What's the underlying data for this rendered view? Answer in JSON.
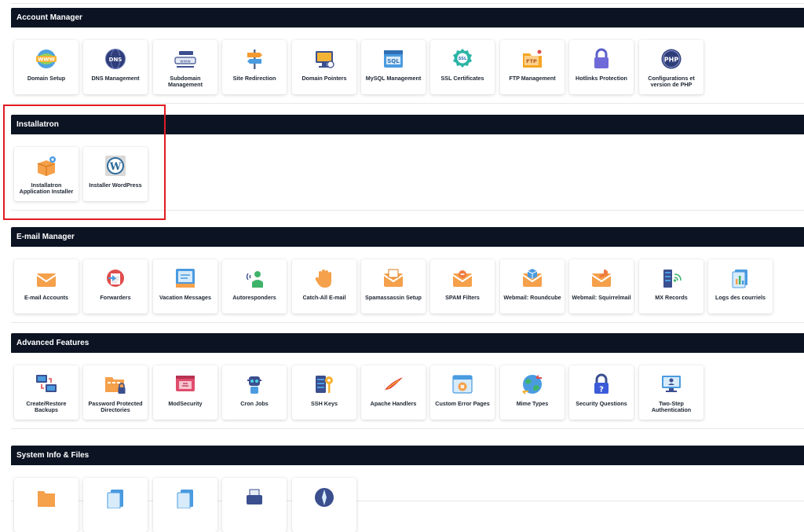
{
  "sections": [
    {
      "title": "Account Manager",
      "items": [
        {
          "label": "Domain Setup",
          "icon": "www-globe-icon"
        },
        {
          "label": "DNS Management",
          "icon": "dns-globe-icon"
        },
        {
          "label": "Subdomain Management",
          "icon": "subdomain-icon"
        },
        {
          "label": "Site Redirection",
          "icon": "signpost-icon"
        },
        {
          "label": "Domain Pointers",
          "icon": "domain-pointer-icon"
        },
        {
          "label": "MySQL Management",
          "icon": "sql-icon"
        },
        {
          "label": "SSL Certificates",
          "icon": "ssl-badge-icon"
        },
        {
          "label": "FTP Management",
          "icon": "ftp-folder-icon"
        },
        {
          "label": "Hotlinks Protection",
          "icon": "padlock-icon"
        },
        {
          "label": "Configurations et version de PHP",
          "icon": "php-icon"
        }
      ]
    },
    {
      "title": "Installatron",
      "items": [
        {
          "label": "Installatron Application Installer",
          "icon": "installatron-box-icon"
        },
        {
          "label": "Installer WordPress",
          "icon": "wordpress-icon"
        }
      ]
    },
    {
      "title": "E-mail Manager",
      "items": [
        {
          "label": "E-mail Accounts",
          "icon": "envelope-icon"
        },
        {
          "label": "Forwarders",
          "icon": "forward-icon"
        },
        {
          "label": "Vacation Messages",
          "icon": "vacation-message-icon"
        },
        {
          "label": "Autoresponders",
          "icon": "autoresponder-icon"
        },
        {
          "label": "Catch-All E-mail",
          "icon": "hand-icon"
        },
        {
          "label": "Spamassassin Setup",
          "icon": "spam-envelope-icon"
        },
        {
          "label": "SPAM Filters",
          "icon": "spam-filter-icon"
        },
        {
          "label": "Webmail: Roundcube",
          "icon": "roundcube-icon"
        },
        {
          "label": "Webmail: Squirrelmail",
          "icon": "squirrelmail-icon"
        },
        {
          "label": "MX Records",
          "icon": "mx-server-icon"
        },
        {
          "label": "Logs des courriels",
          "icon": "mail-logs-icon"
        }
      ]
    },
    {
      "title": "Advanced Features",
      "items": [
        {
          "label": "Create/Restore Backups",
          "icon": "backup-monitors-icon"
        },
        {
          "label": "Password Protected Directories",
          "icon": "protected-folder-icon"
        },
        {
          "label": "ModSecurity",
          "icon": "modsecurity-icon"
        },
        {
          "label": "Cron Jobs",
          "icon": "robot-icon"
        },
        {
          "label": "SSH Keys",
          "icon": "ssh-key-icon"
        },
        {
          "label": "Apache Handlers",
          "icon": "apache-feather-icon"
        },
        {
          "label": "Custom Error Pages",
          "icon": "error-page-icon"
        },
        {
          "label": "Mime Types",
          "icon": "mime-globe-icon"
        },
        {
          "label": "Security Questions",
          "icon": "question-lock-icon"
        },
        {
          "label": "Two-Step Authentication",
          "icon": "two-step-auth-icon"
        }
      ]
    },
    {
      "title": "System Info & Files",
      "items": [
        {
          "label": "",
          "icon": "folder-icon"
        },
        {
          "label": "",
          "icon": "doc-stack-icon"
        },
        {
          "label": "",
          "icon": "doc-stack-icon"
        },
        {
          "label": "",
          "icon": "printer-icon"
        },
        {
          "label": "",
          "icon": "compass-icon"
        }
      ]
    }
  ]
}
